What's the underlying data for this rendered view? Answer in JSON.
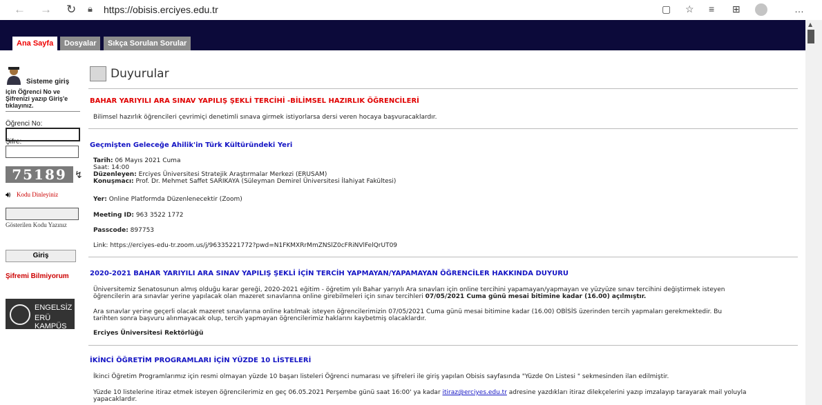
{
  "browser": {
    "url": "https://obisis.erciyes.edu.tr"
  },
  "tabs": [
    {
      "label": "Ana Sayfa"
    },
    {
      "label": "Dosyalar"
    },
    {
      "label": "Sıkça Sorulan Sorular"
    }
  ],
  "sidebar": {
    "login_title": "Sisteme giriş",
    "login_desc": "için Öğrenci No ve Şifrenizi yazıp Giriş'e tıklayınız.",
    "student_no_label": "Öğrenci No:",
    "student_no_value": "",
    "password_label": "Şifre:",
    "password_value": "",
    "captcha": "75189",
    "listen_label": "Kodu Dinleyiniz",
    "code_label": "Gösterilen Kodu Yazınız",
    "login_button": "Giriş",
    "forgot_password": "Şifremi Bilmiyorum",
    "engelsiz_line1": "ENGELSİZ",
    "engelsiz_line2": "ERÜ KAMPÜS"
  },
  "main": {
    "title": "Duyurular",
    "ann1": {
      "title": "BAHAR YARIYILI ARA SINAV YAPILIŞ ŞEKLİ TERCİHİ -BİLİMSEL HAZIRLIK ÖĞRENCİLERİ",
      "body": "Bilimsel hazırlık öğrencileri çevrimiçi denetimli sınava girmek istiyorlarsa dersi veren hocaya başvuracaklardır."
    },
    "ann2": {
      "title": "Geçmişten Geleceğe Ahilik'in Türk Kültüründeki Yeri",
      "date_label": "Tarih:",
      "date_value": " 06 Mayıs 2021 Cuma",
      "time_line": "Saat: 14:00",
      "organizer_label": "Düzenleyen:",
      "organizer_value": " Erciyes Üniversitesi Stratejik Araştırmalar Merkezi (ERUSAM)",
      "speaker_label": "Konuşmacı:",
      "speaker_value": " Prof. Dr. Mehmet Saffet SARIKAYA (Süleyman Demirel Üniversitesi İlahiyat Fakültesi)",
      "place_label": "Yer:",
      "place_value": " Online Platformda Düzenlenecektir (Zoom)",
      "meeting_label": "Meeting ID:",
      "meeting_value": " 963 3522 1772",
      "passcode_label": "Passcode:",
      "passcode_value": " 897753",
      "link_line": "Link: https://erciyes-edu-tr.zoom.us/j/96335221772?pwd=N1FKMXRrMmZNSlZ0cFRiNVlFelQrUT09"
    },
    "ann3": {
      "title": "2020-2021 BAHAR YARIYILI ARA SINAV YAPILIŞ ŞEKLİ İÇİN TERCİH YAPMAYAN/YAPAMAYAN ÖĞRENCİLER HAKKINDA DUYURU",
      "p1_line1": "Üniversitemiz Senatosunun almış olduğu karar gereği, 2020-2021 eğitim - öğretim yılı Bahar yarıyılı Ara sınavları için online tercihini yapamayan/yapmayan ve yüzyüze sınav tercihini değiştirmek isteyen",
      "p1_line2_start": "öğrencilerin ara sınavlar yerine yapılacak olan mazeret sınavlarına online girebilmeleri için sınav tercihleri ",
      "p1_line2_bold": "07/05/2021 Cuma günü mesai bitimine kadar (16.00) açılmıştır.",
      "p2_line1": "Ara sınavlar yerine geçerli olacak mazeret sınavlarına online katılmak isteyen öğrencilerimizin 07/05/2021 Cuma günü mesai bitimine kadar (16.00) OBİSİS üzerinden tercih yapmaları gerekmektedir. Bu",
      "p2_line2": "tarihten sonra başvuru alınmayacak olup, tercih yapmayan öğrencilerimiz haklarını kaybetmiş olacaklardır.",
      "signature": "Erciyes Üniversitesi Rektörlüğü"
    },
    "ann4": {
      "title": "İKİNCİ ÖĞRETİM PROGRAMLARI İÇİN YÜZDE 10 LİSTELERİ",
      "p1": "İkinci Öğretim Programlarımız için resmi olmayan yüzde 10 başarı listeleri Öğrenci numarası ve şifreleri ile giriş yapılan Obisis sayfasında \"Yüzde On Listesi \" sekmesinden ilan edilmiştir.",
      "p2_start": "Yüzde 10 listelerine itiraz etmek isteyen öğrencilerimiz en geç 06.05.2021 Perşembe günü saat 16:00' ya kadar ",
      "p2_email": "itiraz@erciyes.edu.tr",
      "p2_end": " adresine yazdıkları itiraz dilekçelerini yazıp imzalayıp tarayarak mail yoluyla",
      "p2_line2": "yapacaklardır."
    }
  }
}
